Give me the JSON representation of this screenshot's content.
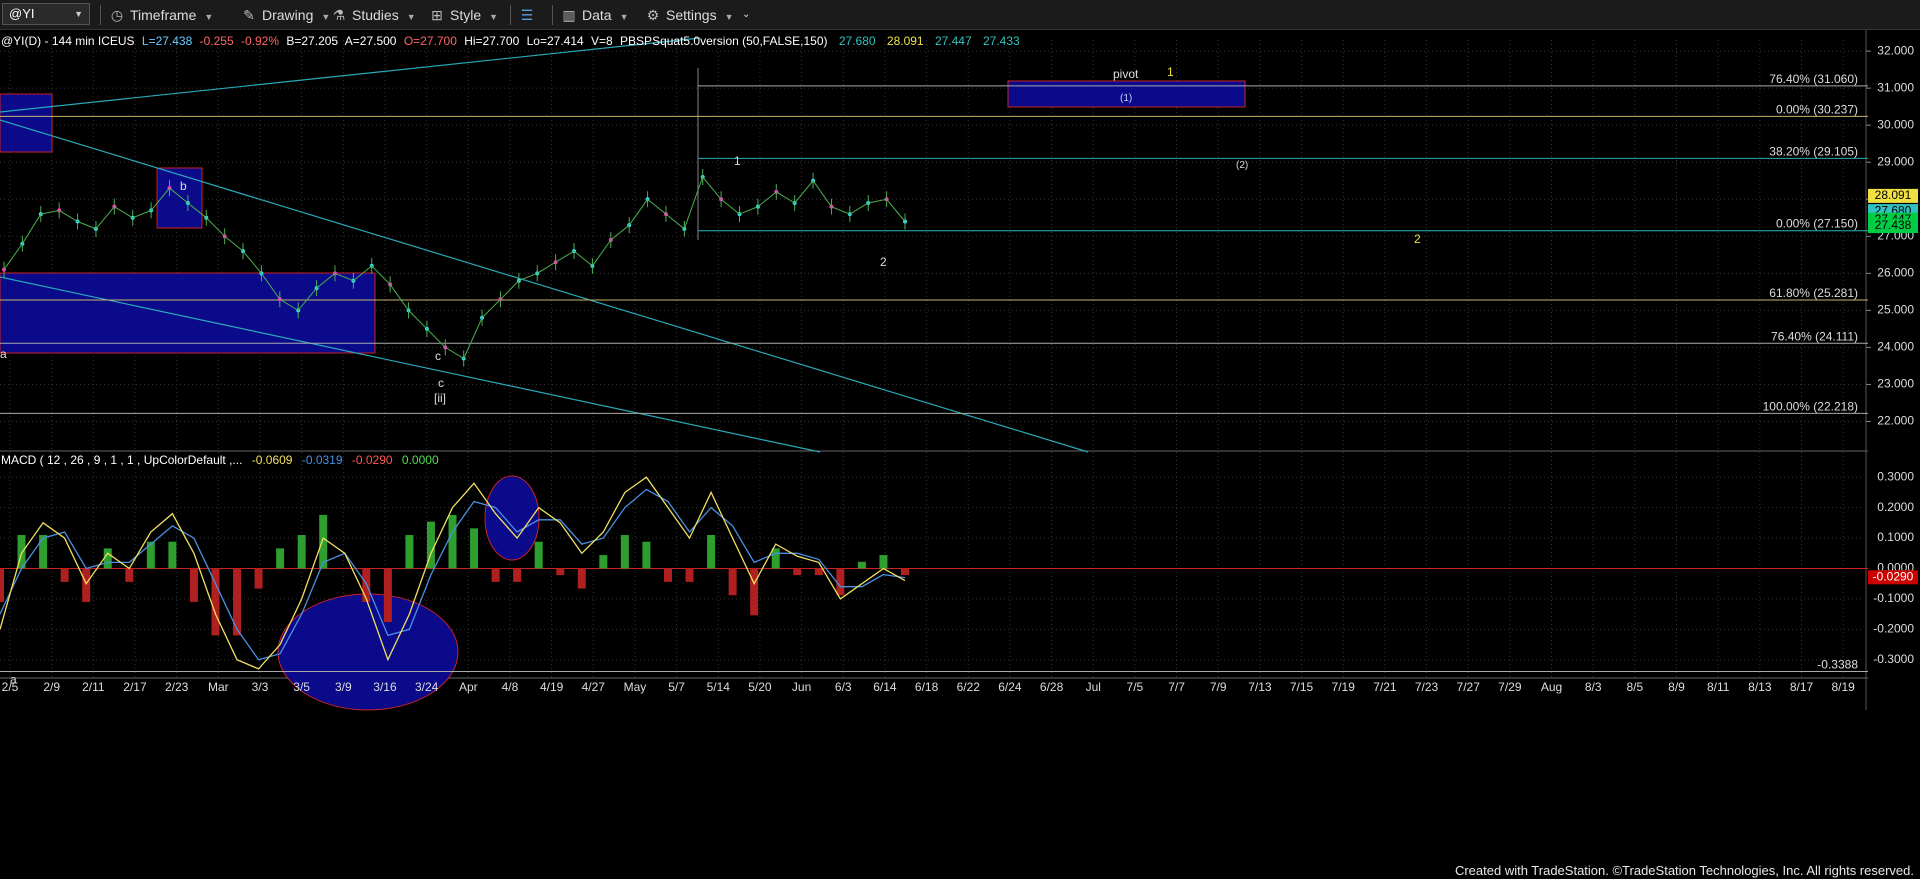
{
  "toolbar": {
    "symbol": "@YI",
    "timeframe_label": "Timeframe",
    "drawing_label": "Drawing",
    "studies_label": "Studies",
    "style_label": "Style",
    "data_label": "Data",
    "settings_label": "Settings"
  },
  "header": {
    "instrument": "@YI(D) - 144 min ICEUS",
    "last": "L=27.438",
    "change": "-0.255",
    "change_pct": "-0.92%",
    "bid": "B=27.205",
    "ask": "A=27.500",
    "open": "O=27.700",
    "high": "Hi=27.700",
    "low": "Lo=27.414",
    "volume": "V=8",
    "study": "PBSPSquat5.0version (50,FALSE,150)",
    "study_values": [
      "27.680",
      "28.091",
      "27.447",
      "27.433"
    ]
  },
  "macd_header": {
    "label": "MACD ( 12 , 26 , 9 , 1 , 1 , UpColorDefault ,...",
    "values": [
      "-0.0609",
      "-0.0319",
      "-0.0290",
      "0.0000"
    ]
  },
  "footer": "Created with TradeStation. ©TradeStation Technologies, Inc. All rights reserved.",
  "colors": {
    "background": "#000000",
    "grid": "#333333",
    "price_up": "#4caf50",
    "trendline": "#29a9b8",
    "box_fill": "#0a0a8a",
    "box_border": "#cc2222",
    "macd_fast": "#f0e060",
    "macd_slow": "#4a90e2",
    "hist_pos": "#2e9e2e",
    "hist_neg": "#b02020",
    "label_yellow": "#f0e040",
    "last_price": "#00cc44",
    "study_cyan": "#33c0c0"
  },
  "chart_data": [
    {
      "type": "line",
      "title": "@YI(D) - 144 min ICEUS",
      "x_labels": [
        "2/5",
        "2/9",
        "2/11",
        "2/17",
        "2/23",
        "Mar",
        "3/3",
        "3/5",
        "3/9",
        "3/16",
        "3/24",
        "Apr",
        "4/8",
        "4/19",
        "4/27",
        "May",
        "5/7",
        "5/14",
        "5/20",
        "Jun",
        "6/3",
        "6/14",
        "6/18",
        "6/22",
        "6/24",
        "6/28",
        "Jul",
        "7/5",
        "7/7",
        "7/9",
        "7/13",
        "7/15",
        "7/19",
        "7/21",
        "7/23",
        "7/27",
        "7/29",
        "Aug",
        "8/3",
        "8/5",
        "8/9",
        "8/11",
        "8/13",
        "8/17",
        "8/19"
      ],
      "ylim": [
        21.5,
        32.3
      ],
      "y_ticks": [
        22.0,
        23.0,
        24.0,
        25.0,
        26.0,
        27.0,
        28.0,
        29.0,
        30.0,
        31.0,
        32.0
      ],
      "y_tick_labels": [
        "22.000",
        "23.000",
        "24.000",
        "25.000",
        "26.000",
        "27.000",
        "28.000",
        "29.000",
        "30.000",
        "31.000",
        "32.000"
      ],
      "series": [
        {
          "name": "Price",
          "values": [
            26.1,
            26.8,
            27.6,
            27.7,
            27.4,
            27.2,
            27.8,
            27.5,
            27.7,
            28.3,
            27.9,
            27.5,
            27.0,
            26.6,
            26.0,
            25.3,
            25.0,
            25.6,
            26.0,
            25.8,
            26.2,
            25.7,
            25.0,
            24.5,
            24.0,
            23.7,
            24.8,
            25.3,
            25.8,
            26.0,
            26.3,
            26.6,
            26.2,
            26.9,
            27.3,
            28.0,
            27.6,
            27.2,
            28.6,
            28.0,
            27.6,
            27.8,
            28.2,
            27.9,
            28.5,
            27.8,
            27.6,
            27.9,
            28.0,
            27.4
          ]
        }
      ],
      "fib_levels": [
        {
          "label": "76.40% (31.060)",
          "value": 31.06
        },
        {
          "label": "0.00% (30.237)",
          "value": 30.237
        },
        {
          "label": "38.20% (29.105)",
          "value": 29.105
        },
        {
          "label": "0.00% (27.150)",
          "value": 27.15
        },
        {
          "label": "61.80% (25.281)",
          "value": 25.281
        },
        {
          "label": "76.40% (24.111)",
          "value": 24.111
        },
        {
          "label": "100.00% (22.218)",
          "value": 22.218
        }
      ],
      "price_badges": [
        {
          "label": "28.091",
          "value": 28.091,
          "kind": "yellow"
        },
        {
          "label": "27.680",
          "value": 27.68,
          "kind": "cyan"
        },
        {
          "label": "27.447",
          "value": 27.447,
          "kind": "green"
        },
        {
          "label": "27.438",
          "value": 27.438,
          "kind": "green"
        }
      ],
      "annotations": [
        "b",
        "a",
        "c",
        "c",
        "[ii]",
        "1",
        "2",
        "pivot",
        "1",
        "(1)",
        "(2)",
        "2"
      ]
    },
    {
      "type": "bar",
      "title": "MACD ( 12 , 26 , 9 , 1 , 1 , UpColorDefault ,...",
      "ylim": [
        -0.36,
        0.35
      ],
      "y_ticks": [
        0.3,
        0.2,
        0.1,
        0.0,
        -0.1,
        -0.2,
        -0.3
      ],
      "y_tick_labels": [
        "0.3000",
        "0.2000",
        "0.1000",
        "0.0000",
        "-0.1000",
        "-0.2000",
        "-0.3000"
      ],
      "reference_line": {
        "label": "-0.3388",
        "value": -0.3388
      },
      "badge": {
        "label": "-0.0290",
        "value": -0.029
      },
      "series": [
        {
          "name": "MACD",
          "values": [
            -0.2,
            0.05,
            0.15,
            0.1,
            -0.05,
            0.05,
            0.0,
            0.12,
            0.18,
            0.05,
            -0.15,
            -0.3,
            -0.33,
            -0.25,
            -0.1,
            0.1,
            0.05,
            -0.1,
            -0.3,
            -0.15,
            0.05,
            0.2,
            0.28,
            0.18,
            0.1,
            0.2,
            0.15,
            0.05,
            0.12,
            0.25,
            0.3,
            0.2,
            0.1,
            0.25,
            0.1,
            -0.05,
            0.08,
            0.04,
            0.02,
            -0.1,
            -0.05,
            0.0,
            -0.04
          ]
        },
        {
          "name": "Signal",
          "values": [
            -0.15,
            0.0,
            0.1,
            0.12,
            0.0,
            0.02,
            0.02,
            0.08,
            0.14,
            0.1,
            -0.05,
            -0.2,
            -0.3,
            -0.28,
            -0.15,
            0.02,
            0.05,
            -0.05,
            -0.22,
            -0.2,
            -0.02,
            0.12,
            0.22,
            0.2,
            0.12,
            0.16,
            0.16,
            0.08,
            0.1,
            0.2,
            0.26,
            0.22,
            0.12,
            0.2,
            0.14,
            0.02,
            0.05,
            0.05,
            0.03,
            -0.06,
            -0.06,
            -0.02,
            -0.03
          ]
        }
      ]
    }
  ]
}
